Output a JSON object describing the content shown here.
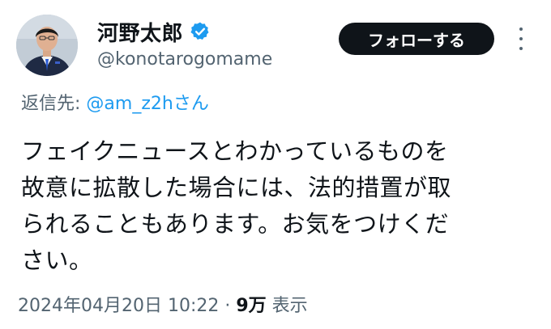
{
  "author": {
    "display_name": "河野太郎",
    "handle": "@konotarogomame",
    "verified_icon": "verified-badge-icon",
    "verified_color": "#1d9bf0"
  },
  "actions": {
    "follow_label": "フォローする",
    "more_icon": "more-dots-icon"
  },
  "reply": {
    "prefix": "返信先: ",
    "mention": "@am_z2h",
    "suffix": "さん"
  },
  "tweet": {
    "lines": [
      "フェイクニュースとわかっているものを",
      "故意に拡散した場合には、法的措置が取",
      "られることもあります。お気をつけくだ",
      "さい。"
    ]
  },
  "meta": {
    "timestamp": "2024年04月20日 10:22",
    "separator": " · ",
    "views_count": "9万",
    "views_label": " 表示"
  },
  "colors": {
    "text": "#0f1419",
    "secondary": "#536471",
    "accent": "#1d9bf0",
    "button_bg": "#0f1419"
  }
}
